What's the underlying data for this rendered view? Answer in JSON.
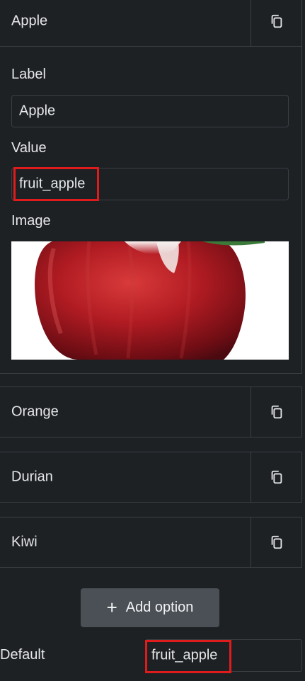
{
  "options": [
    {
      "label": "Apple",
      "expanded": true
    },
    {
      "label": "Orange",
      "expanded": false
    },
    {
      "label": "Durian",
      "expanded": false
    },
    {
      "label": "Kiwi",
      "expanded": false
    }
  ],
  "apple_panel": {
    "label_field_label": "Label",
    "label_value": "Apple",
    "value_field_label": "Value",
    "value_value": "fruit_apple",
    "image_field_label": "Image"
  },
  "add_option_label": "Add option",
  "default_label": "Default",
  "default_value": "fruit_apple",
  "colors": {
    "background": "#1e2124",
    "border": "#3a3d42",
    "button": "#4b5057",
    "highlight": "#e01b1b",
    "text": "#e6e7e9"
  },
  "icons": {
    "copy": "copy-icon",
    "add": "plus-icon"
  }
}
